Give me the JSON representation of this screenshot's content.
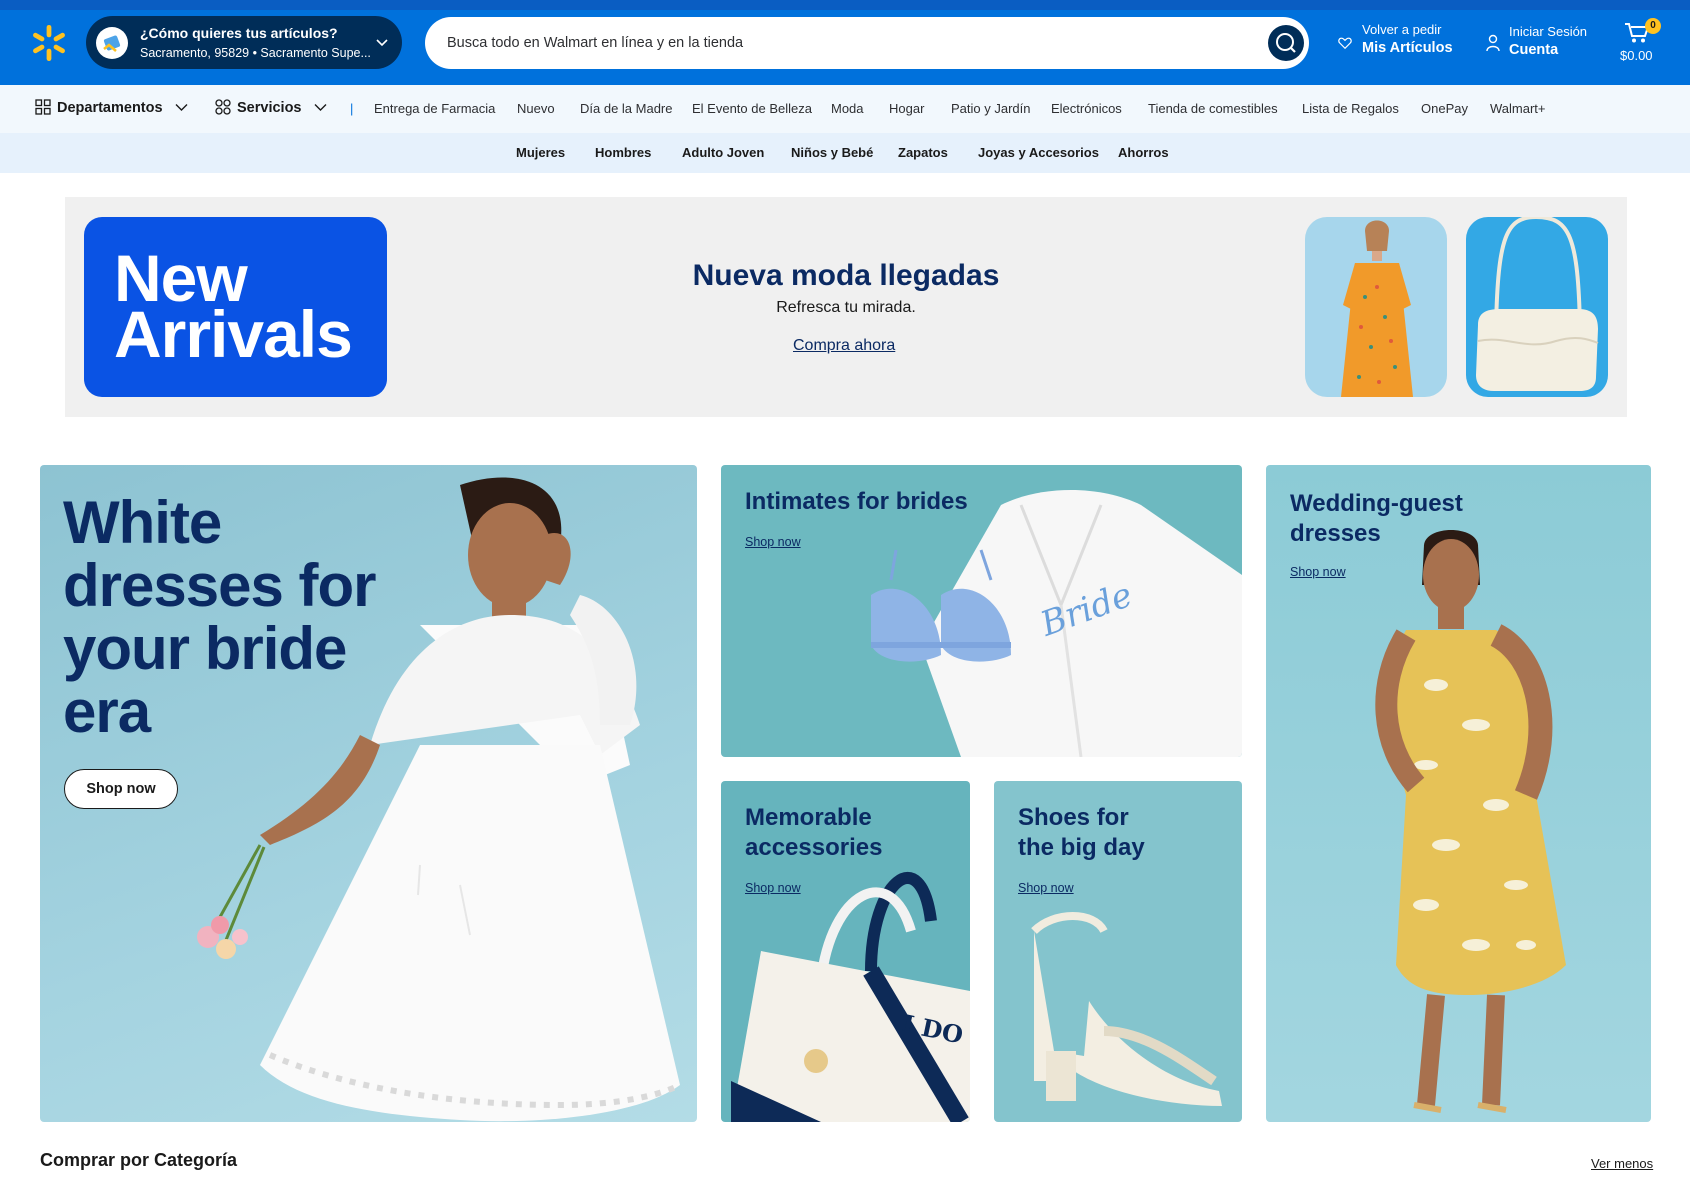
{
  "header": {
    "pickup": {
      "title": "¿Cómo quieres tus artículos?",
      "subtitle": "Sacramento, 95829 • Sacramento Supe..."
    },
    "search": {
      "placeholder": "Busca todo en Walmart en línea y en la tienda"
    },
    "reorder": {
      "line1": "Volver a pedir",
      "line2": "Mis Artículos"
    },
    "account": {
      "line1": "Iniciar Sesión",
      "line2": "Cuenta"
    },
    "cart": {
      "count": "0",
      "total": "$0.00"
    },
    "colors": {
      "brand_blue": "#0071dc",
      "dark_navy": "#002d58",
      "spark_yellow": "#ffc220"
    }
  },
  "nav": {
    "departments_label": "Departamentos",
    "services_label": "Servicios",
    "separator": "|",
    "links": [
      "Entrega de Farmacia",
      "Nuevo",
      "Día de la Madre",
      "El Evento de Belleza",
      "Moda",
      "Hogar",
      "Patio y Jardín",
      "Electrónicos",
      "Tienda de comestibles",
      "Lista de Regalos",
      "OnePay",
      "Walmart+"
    ]
  },
  "subnav": {
    "links": [
      "Mujeres",
      "Hombres",
      "Adulto Joven",
      "Niños y Bebé",
      "Zapatos",
      "Joyas y Accesorios",
      "Ahorros"
    ]
  },
  "promo": {
    "badge_line1": "New",
    "badge_line2": "Arrivals",
    "title": "Nueva moda llegadas",
    "subtitle": "Refresca tu mirada.",
    "link": "Compra ahora"
  },
  "tiles": {
    "main": {
      "lines": [
        "White",
        "dresses for",
        "your bride",
        "era"
      ],
      "button": "Shop now"
    },
    "intimates": {
      "title": "Intimates for brides",
      "link": "Shop now",
      "robe_text": "Bride"
    },
    "accessories": {
      "lines": [
        "Memorable",
        "accessories"
      ],
      "link": "Shop now",
      "bag_text": "I DO"
    },
    "shoes": {
      "lines": [
        "Shoes for",
        "the big day"
      ],
      "link": "Shop now"
    },
    "guest": {
      "lines": [
        "Wedding-guest",
        "dresses"
      ],
      "link": "Shop now"
    }
  },
  "category": {
    "title": "Comprar por Categoría",
    "toggle": "Ver menos"
  }
}
